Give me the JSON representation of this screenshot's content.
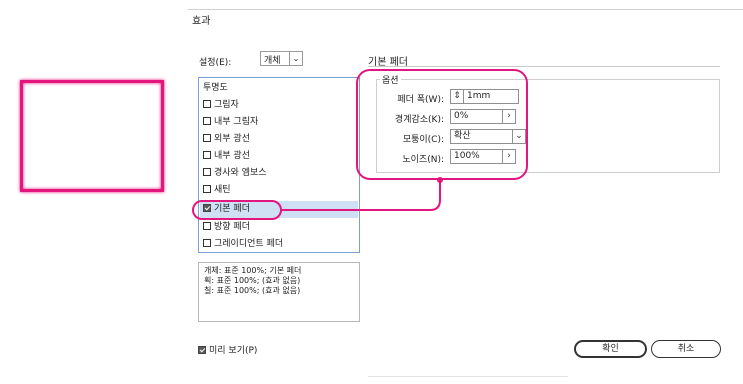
{
  "dialog": {
    "title": "효과"
  },
  "settings": {
    "label": "설정(E):",
    "value": "개체",
    "arrow_icon": "chevron-down-icon"
  },
  "effects_list": {
    "header": "투명도",
    "items": [
      {
        "label": "그림자",
        "checked": false
      },
      {
        "label": "내부 그림자",
        "checked": false
      },
      {
        "label": "외부 광선",
        "checked": false
      },
      {
        "label": "내부 광선",
        "checked": false
      },
      {
        "label": "경사와 엠보스",
        "checked": false
      },
      {
        "label": "새틴",
        "checked": false
      },
      {
        "label": "기본 페더",
        "checked": true,
        "selected": true
      },
      {
        "label": "방향 페더",
        "checked": false
      },
      {
        "label": "그레이디언트 페더",
        "checked": false
      }
    ]
  },
  "summary": [
    "개체: 표준 100%; 기본 페더",
    "획: 표준 100%; (효과 없음)",
    "칠: 표준 100%; (효과 없음)"
  ],
  "section": {
    "title": "기본 페더"
  },
  "options": {
    "legend": "옵션",
    "feather_width": {
      "label": "페더 폭(W):",
      "value": "1mm",
      "spinner_icon": "spinner-icon"
    },
    "choke": {
      "label": "경계감소(K):",
      "value": "0%",
      "arrow_icon": "chevron-right-icon"
    },
    "corners": {
      "label": "모퉁이(C):",
      "value": "확산",
      "arrow_icon": "chevron-down-icon"
    },
    "noise": {
      "label": "노이즈(N):",
      "value": "100%",
      "arrow_icon": "chevron-right-icon"
    }
  },
  "preview": {
    "label": "미리 보기(P)",
    "checked": true
  },
  "buttons": {
    "ok": "확인",
    "cancel": "취소"
  },
  "colors": {
    "accent_callout": "#e2167e",
    "selection": "#cfe0f5",
    "list_border": "#7aa0d6"
  }
}
